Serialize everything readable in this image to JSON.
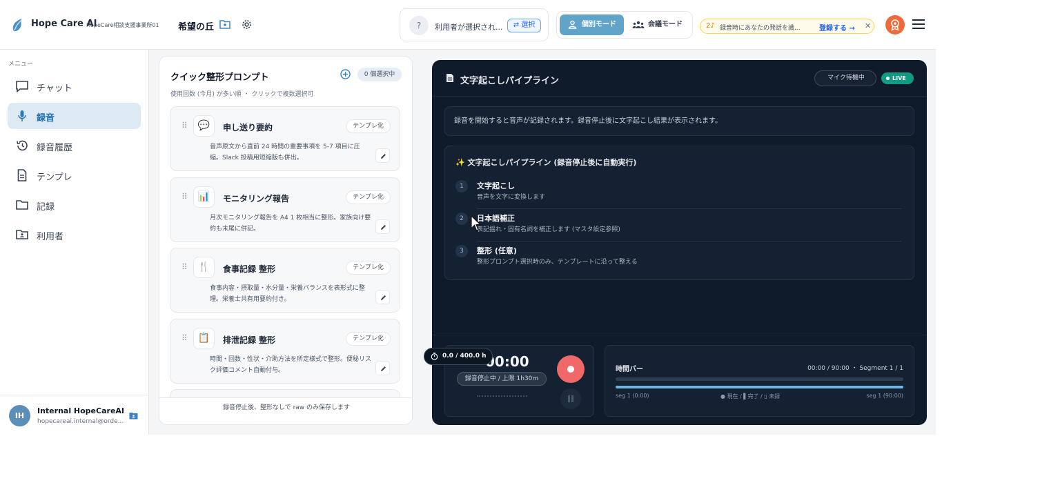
{
  "header": {
    "brand": "Hope Care AI",
    "org": "HopeCare相談支援事業所01",
    "facility": "希望の丘",
    "user_selector": {
      "placeholder_text": "利用者が選択され...",
      "icon_text": "?",
      "select_label": "⇄ 選択"
    },
    "modes": {
      "personal": "個別モード",
      "meeting": "会議モード",
      "active": "personal"
    },
    "banner": {
      "icon_text": "2♪",
      "text": "録音時にあなたの発話を識...",
      "link": "登録する →",
      "close": "✕"
    }
  },
  "sidebar": {
    "menu_label": "メニュー",
    "items": [
      {
        "label": "チャット",
        "icon": "chat-icon"
      },
      {
        "label": "録音",
        "icon": "mic-icon",
        "active": true
      },
      {
        "label": "録音履歴",
        "icon": "history-icon"
      },
      {
        "label": "テンプレ",
        "icon": "document-icon"
      },
      {
        "label": "記録",
        "icon": "folder-icon"
      },
      {
        "label": "利用者",
        "icon": "user-folder-icon"
      }
    ],
    "account": {
      "initials": "IH",
      "name": "Internal HopeCareAI",
      "email": "hopecareai.internal@orde..."
    }
  },
  "prompts": {
    "title": "クイック整形プロンプト",
    "selected_count": "0 個選択中",
    "subtitle": "使用回数 (今月) が多い順 ・ クリックで複数選択可",
    "tag_label": "テンプレ化",
    "cards": [
      {
        "icon": "💬",
        "title": "申し送り要約",
        "desc": "音声原文から直前 24 時間の重要事項を 5-7 項目に圧縮。Slack 投稿用短縮版も併出。"
      },
      {
        "icon": "📊",
        "title": "モニタリング報告",
        "desc": "月次モニタリング報告を A4 1 枚相当に整形。家族向け要約も末尾に併記。"
      },
      {
        "icon": "🍴",
        "title": "食事記録 整形",
        "desc": "食事内容・摂取量・水分量・栄養バランスを表形式に整理。栄養士共有用要約付き。"
      },
      {
        "icon": "📋",
        "title": "排泄記録 整形",
        "desc": "時間・回数・性状・介助方法を所定様式で整形。便秘リスク評価コメント自動付与。"
      }
    ],
    "footer": "録音停止後、整形なしで raw のみ保存します"
  },
  "pipeline": {
    "title": "文字起こしパイプライン",
    "mic_status": "マイク待機中",
    "live_label": "LIVE",
    "info": "録音を開始すると音声が記録されます。録音停止後に文字起こし結果が表示されます。",
    "steps_title": "✨ 文字起こしパイプライン (録音停止後に自動実行)",
    "steps": [
      {
        "num": "1",
        "title": "文字起こし",
        "desc": "音声を文字に変換します"
      },
      {
        "num": "2",
        "title": "日本語補正",
        "desc": "表記揺れ・固有名詞を補正します (マスタ設定参照)"
      },
      {
        "num": "3",
        "title": "整形 (任意)",
        "desc": "整形プロンプト選択時のみ、テンプレートに沿って整える"
      }
    ],
    "recorder": {
      "time": "00:00",
      "status": "録音停止中 / 上限 1h30m"
    },
    "timebar": {
      "title": "時間バー",
      "meta": "00:00 / 90:00 ・ Segment 1 / 1",
      "left": "seg 1 (0:00)",
      "legend": "● 現在 / ▌完了 / ▯ 未録",
      "right": "seg 1 (90:00)"
    },
    "quota": "0.0 / 400.0 h"
  },
  "colors": {
    "accent": "#60a5c9",
    "record": "#f06868",
    "dark_panel": "#0f1b2b",
    "live": "#0f9b84"
  }
}
